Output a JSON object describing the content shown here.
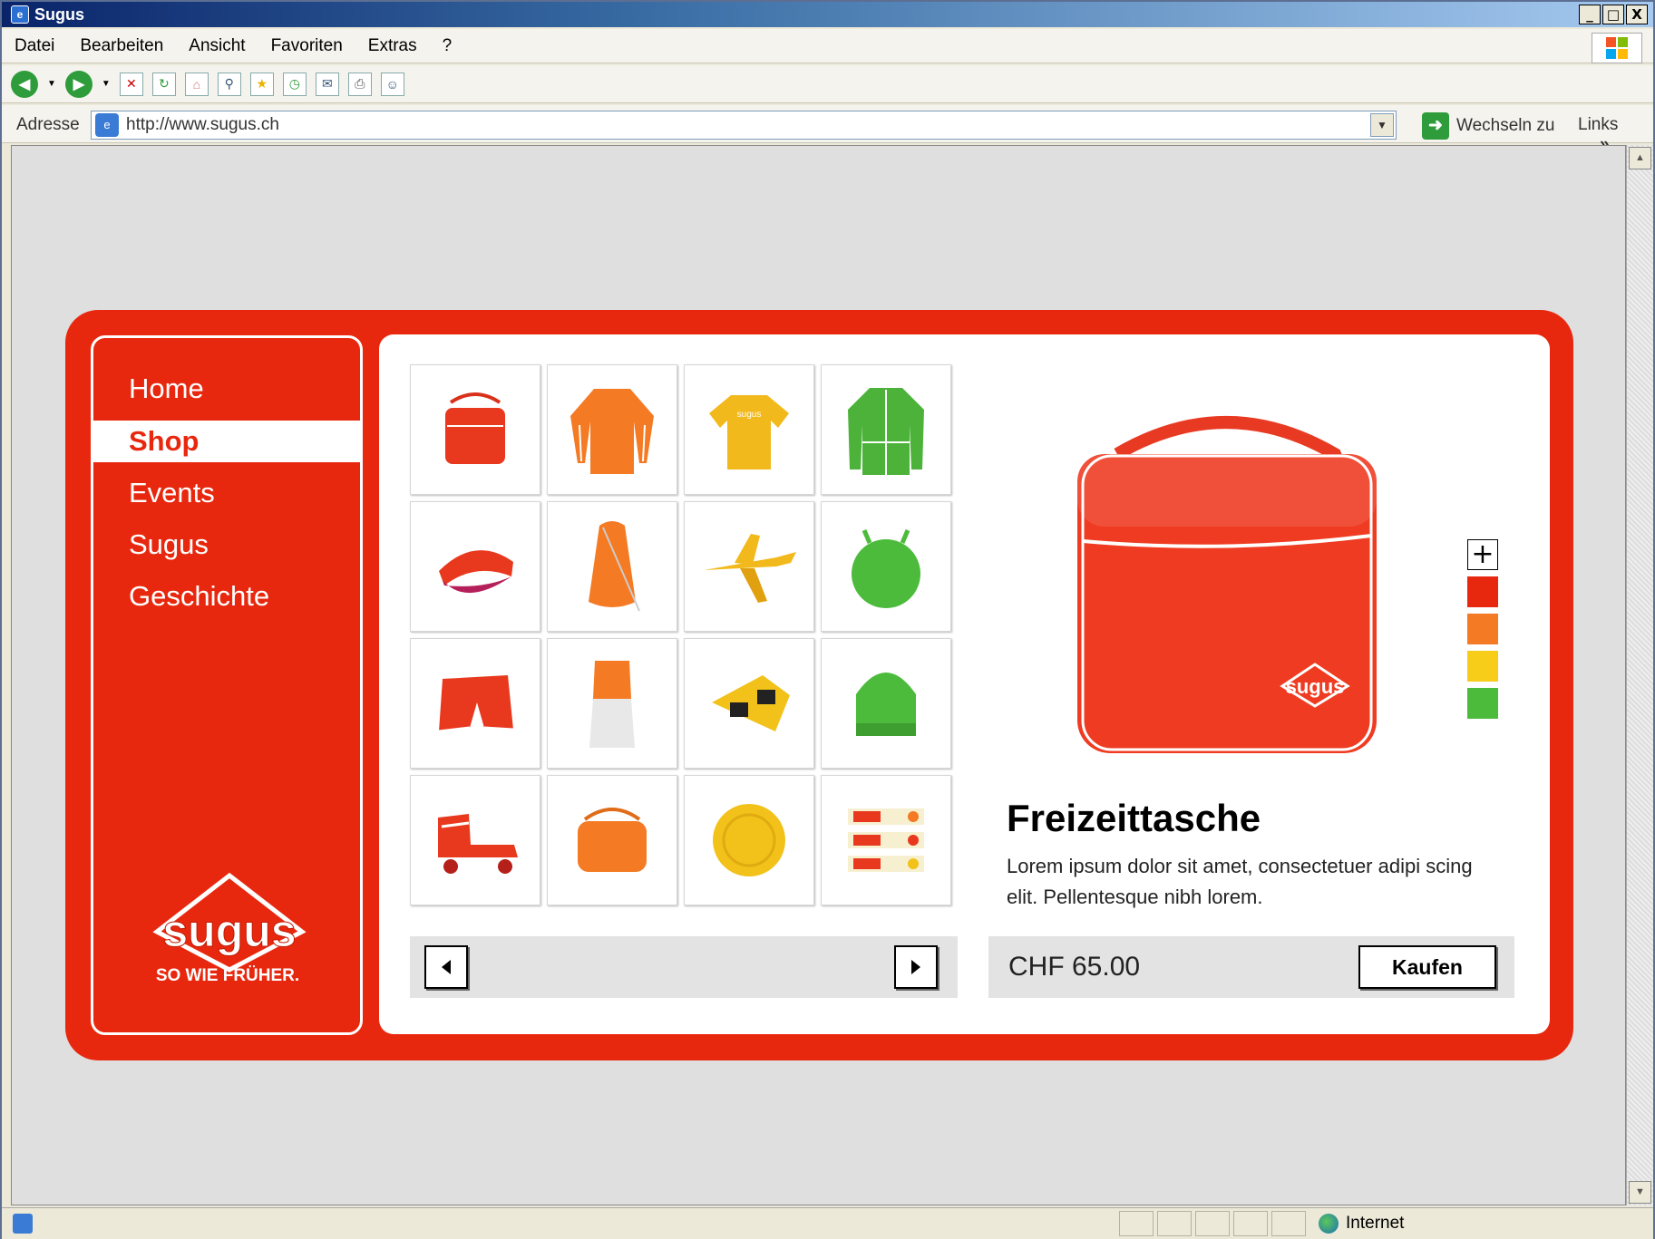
{
  "window": {
    "title": "Sugus",
    "buttons": {
      "minimize": "_",
      "maximize": "□",
      "close": "X"
    }
  },
  "menu": [
    "Datei",
    "Bearbeiten",
    "Ansicht",
    "Favoriten",
    "Extras",
    "?"
  ],
  "address": {
    "label": "Adresse",
    "url": "http://www.sugus.ch",
    "go_label": "Wechseln zu",
    "links_label": "Links",
    "more": "»"
  },
  "status": {
    "zone": "Internet"
  },
  "site": {
    "nav": [
      "Home",
      "Shop",
      "Events",
      "Sugus",
      "Geschichte"
    ],
    "active_nav": "Shop",
    "logo_text": "sugus",
    "slogan": "SO WIE FRÜHER.",
    "colors": {
      "brand_red": "#e8280e",
      "orange": "#f47a24",
      "yellow": "#f7cd1a",
      "green": "#4cbb3c"
    },
    "products": [
      "red bag",
      "orange long-sleeve shirt",
      "yellow t-shirt",
      "green jacket",
      "visor",
      "orange drawstring bag",
      "yellow toy plane",
      "green hopper ball",
      "red shorts",
      "orange and white bottle bag",
      "yellow-black sunglasses",
      "green beanie",
      "red roller skates",
      "orange bag",
      "yellow ball",
      "candy packs"
    ],
    "pager": {
      "prev_icon": "triangle-left-icon",
      "next_icon": "triangle-right-icon"
    },
    "detail": {
      "title": "Freizeittasche",
      "description": "Lorem ipsum dolor sit amet, consectetuer adipi scing elit. Pellentesque nibh lorem.",
      "price": "CHF 65.00",
      "buy_label": "Kaufen",
      "bag_logo": "sugus",
      "swatches": [
        "#e8280e",
        "#f47a24",
        "#f7cd1a",
        "#4cbb3c"
      ],
      "zoom_label": "+"
    }
  }
}
